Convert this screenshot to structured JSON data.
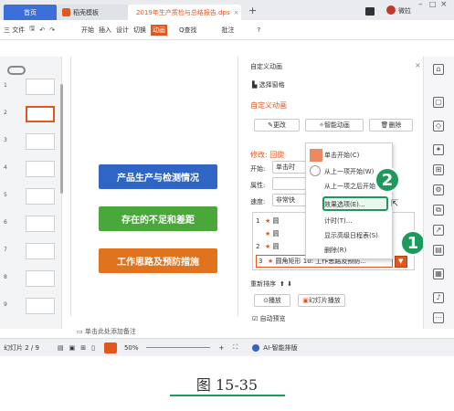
{
  "tabs": {
    "home": "首页",
    "templates": "稻壳模板",
    "document": "2019年生产质检与总结报告.dps"
  },
  "window": {
    "user_label": "微拉"
  },
  "toolbar": {
    "file": "三 文件",
    "play": "开始",
    "insert": "插入",
    "design": "设计",
    "transition": "切换",
    "animation": "动画",
    "search": "Q查找",
    "comment": "批注"
  },
  "thumbs": [
    "1",
    "2",
    "3",
    "4",
    "5",
    "6",
    "7",
    "8",
    "9"
  ],
  "slide": {
    "bars": [
      {
        "text": "产品生产与检测情况",
        "color": "#2f65c4"
      },
      {
        "text": "存在的不足和差距",
        "color": "#4aa83a"
      },
      {
        "text": "工作思路及预防措施",
        "color": "#e0731e"
      }
    ],
    "notes": "单击此处添加备注"
  },
  "pane": {
    "title": "自定义动画",
    "select_pane": "选择窗格",
    "section": "自定义动画",
    "change_btn": "更改",
    "smart_btn": "智能动画",
    "delete_btn": "删除",
    "modify": "修改: 回旋",
    "start_label": "开始:",
    "start_value": "单击时",
    "prop_label": "属性:",
    "speed_label": "速度:",
    "speed_value": "非常快",
    "list": [
      {
        "n": "1",
        "text": "圆"
      },
      {
        "n": "",
        "text": "圆"
      },
      {
        "n": "2",
        "text": "圆"
      },
      {
        "n": "3",
        "text": "圆角矩形 10: 工作思路及预防..."
      }
    ],
    "reorder": "重新排序",
    "play": "播放",
    "slideshow": "幻灯片播放",
    "autopreview": "自动预览"
  },
  "menu": {
    "items": [
      "单击开始(C)",
      "从上一项开始(W)",
      "从上一项之后开始",
      "效果选项(E)...",
      "计时(T)...",
      "显示高级日程表(S)",
      "删除(R)"
    ]
  },
  "markers": [
    "1",
    "2"
  ],
  "status": {
    "slide_count": "幻灯片 2 / 9",
    "zoom": "50%",
    "ai": "AI-智能排版"
  },
  "caption": "图 15-35"
}
